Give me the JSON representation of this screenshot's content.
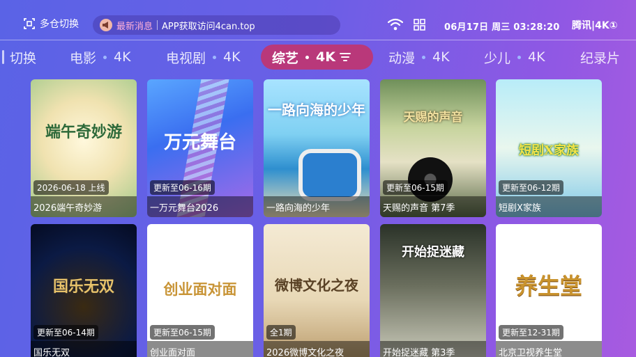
{
  "header": {
    "warehouse_label": "多仓切换",
    "news_tag": "最新消息",
    "news_text": "APP获取访问4can.top",
    "clock": "06月17日 周三 03:28:20",
    "source": "腾讯|4K①"
  },
  "tabs": [
    {
      "label": "切换",
      "suffix": ""
    },
    {
      "label": "电影",
      "suffix": "4K"
    },
    {
      "label": "电视剧",
      "suffix": "4K"
    },
    {
      "label": "综艺",
      "suffix": "4K"
    },
    {
      "label": "动漫",
      "suffix": "4K"
    },
    {
      "label": "少儿",
      "suffix": "4K"
    },
    {
      "label": "纪录片",
      "suffix": ""
    }
  ],
  "active_tab": "综艺",
  "cards": [
    {
      "title": "2026端午奇妙游",
      "badge": "2026-06-18 上线",
      "poster_text": "端午奇妙游",
      "colors": [
        "#f4e9c8",
        "#9ec77a"
      ]
    },
    {
      "title": "一万元舞台2026",
      "badge": "更新至06-16期",
      "poster_text": "万元舞台",
      "colors": [
        "#3a7bf0",
        "#b86be8"
      ]
    },
    {
      "title": "一路向海的少年",
      "badge": "",
      "poster_text": "一路向海的少年",
      "colors": [
        "#7fd2f5",
        "#2f8fcf"
      ]
    },
    {
      "title": "天赐的声音 第7季",
      "badge": "更新至06-15期",
      "poster_text": "天赐的声音",
      "colors": [
        "#c8d6a0",
        "#3b5f3a"
      ]
    },
    {
      "title": "短剧X家族",
      "badge": "更新至06-12期",
      "poster_text": "短剧X家族",
      "colors": [
        "#a9e0f0",
        "#f0f5d0"
      ]
    },
    {
      "title": "国乐无双",
      "badge": "更新至06-14期",
      "poster_text": "国乐无双",
      "colors": [
        "#0b1a44",
        "#c9922f"
      ]
    },
    {
      "title": "创业面对面",
      "badge": "更新至06-15期",
      "poster_text": "创业面对面",
      "colors": [
        "#ffffff",
        "#e8eef8"
      ]
    },
    {
      "title": "2026微博文化之夜",
      "badge": "全1期",
      "poster_text": "微博文化之夜",
      "colors": [
        "#f1e6cf",
        "#c7a97b"
      ]
    },
    {
      "title": "开始捉迷藏 第3季",
      "badge": "",
      "poster_text": "开始捉迷藏",
      "colors": [
        "#3c4a3a",
        "#d7d7c8"
      ]
    },
    {
      "title": "北京卫视养生堂",
      "badge": "更新至12-31期",
      "poster_text": "养生堂",
      "colors": [
        "#ffffff",
        "#fbf6ec"
      ]
    }
  ],
  "icons": [
    "warehouse-switch-icon",
    "horn-icon",
    "wifi-icon",
    "grid-icon",
    "filter-icon"
  ]
}
